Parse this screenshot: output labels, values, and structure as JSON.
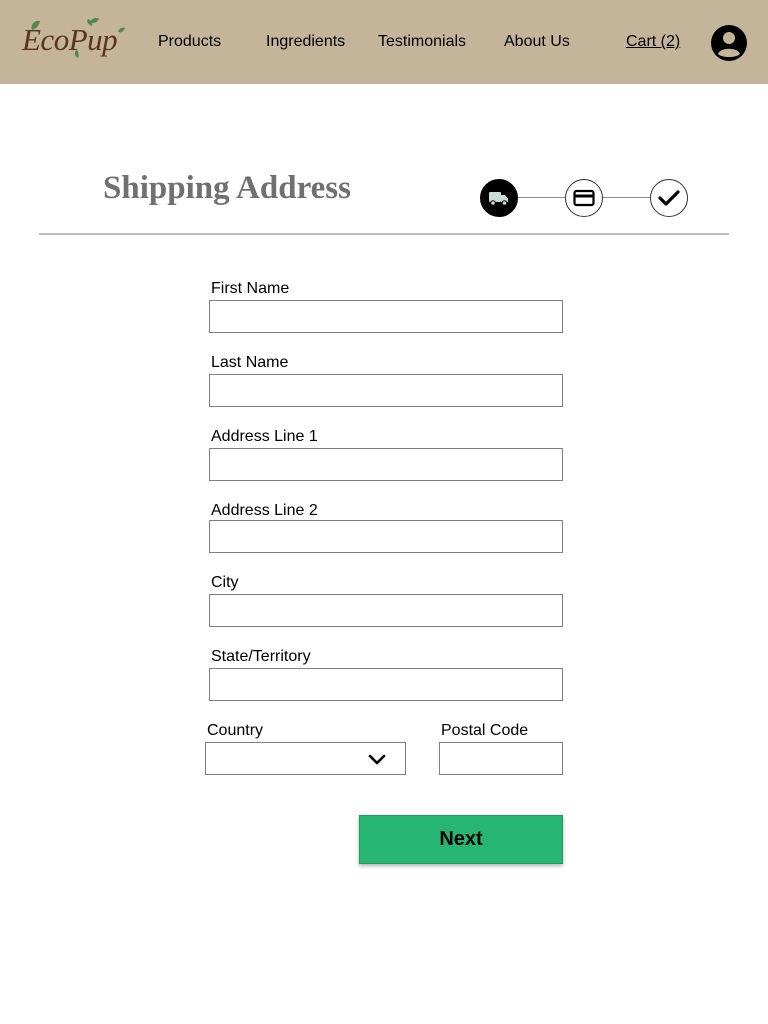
{
  "brand": {
    "logo_text": "EcoPup",
    "header_color": "#c4b59a",
    "logo_color": "#5a3420",
    "leaf_color": "#4f8a4a"
  },
  "nav": {
    "products": "Products",
    "ingredients": "Ingredients",
    "testimonials": "Testimonials",
    "about": "About Us",
    "cart": "Cart (2)",
    "account_icon": "user-circle-icon"
  },
  "checkout": {
    "title": "Shipping Address",
    "steps": [
      {
        "icon": "truck-icon",
        "state": "active"
      },
      {
        "icon": "credit-card-icon",
        "state": "pending"
      },
      {
        "icon": "checkmark-icon",
        "state": "pending"
      }
    ]
  },
  "form": {
    "first_name": {
      "label": "First Name",
      "value": "",
      "placeholder": ""
    },
    "last_name": {
      "label": "Last Name",
      "value": "",
      "placeholder": ""
    },
    "address1": {
      "label": "Address Line 1",
      "value": "",
      "placeholder": ""
    },
    "address2": {
      "label": "Address Line 2",
      "value": "",
      "placeholder": ""
    },
    "city": {
      "label": "City",
      "value": "",
      "placeholder": ""
    },
    "state": {
      "label": "State/Territory",
      "value": "",
      "placeholder": ""
    },
    "country": {
      "label": "Country",
      "value": ""
    },
    "postal": {
      "label": "Postal Code",
      "value": "",
      "placeholder": ""
    },
    "next_label": "Next",
    "next_color": "#27b573"
  }
}
